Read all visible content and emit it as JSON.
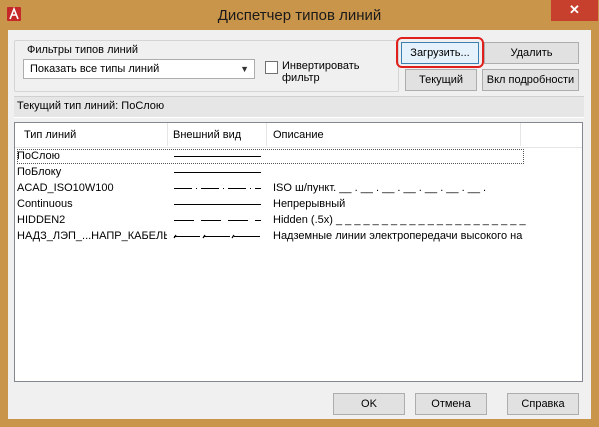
{
  "window": {
    "title": "Диспетчер типов линий",
    "close_label": "✕",
    "app_icon": "autocad-logo-icon"
  },
  "filters": {
    "group_label": "Фильтры типов линий",
    "dropdown_value": "Показать все типы линий",
    "invert_label": "Инвертировать фильтр",
    "invert_checked": false
  },
  "buttons": {
    "load": "Загрузить...",
    "delete": "Удалить",
    "current": "Текущий",
    "details": "Вкл подробности",
    "ok": "OK",
    "cancel": "Отмена",
    "help": "Справка"
  },
  "current_linetype": {
    "label": "Текущий тип линий:",
    "value": "ПоСлою"
  },
  "list": {
    "columns": [
      "Тип линий",
      "Внешний вид",
      "Описание"
    ],
    "rows": [
      {
        "name": "ПоСлою",
        "pattern": "solid",
        "description": "",
        "selected": true
      },
      {
        "name": "ПоБлоку",
        "pattern": "solid",
        "description": "",
        "selected": false
      },
      {
        "name": "ACAD_ISO10W100",
        "pattern": "dash-dot",
        "description": "ISO ш/пункт. __ . __ . __ . __ . __ . __ . __ .",
        "selected": false
      },
      {
        "name": "Continuous",
        "pattern": "solid",
        "description": "Непрерывный",
        "selected": false
      },
      {
        "name": "HIDDEN2",
        "pattern": "dashed",
        "description": "Hidden (.5x) _ _ _ _ _ _ _ _ _ _ _ _ _ _ _ _ _ _ _ _ _",
        "selected": false
      },
      {
        "name": "НАДЗ_ЛЭП_...НАПР_КАБЕЛЬ",
        "pattern": "powerline",
        "description": "Надземные линии электропередачи высокого на",
        "selected": false
      }
    ]
  }
}
